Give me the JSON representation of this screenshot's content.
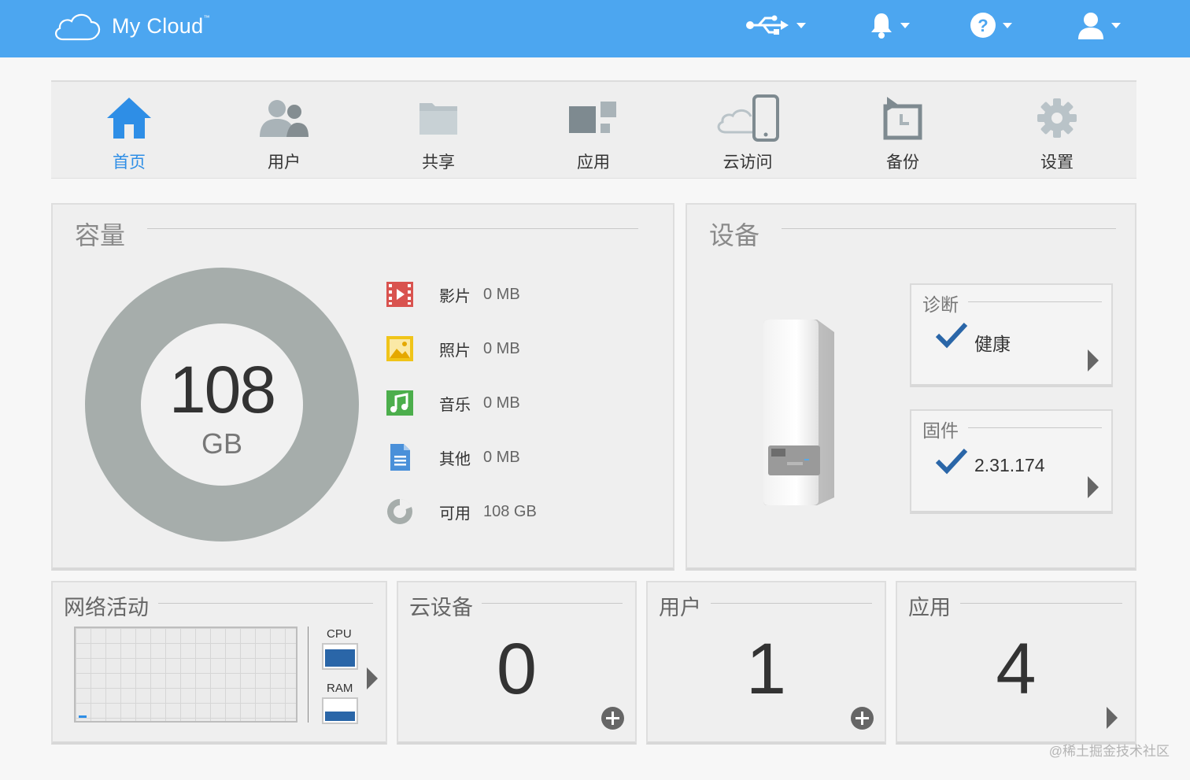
{
  "header": {
    "app_name": "My Cloud",
    "trademark": "™",
    "icons": [
      "cloud-logo-icon",
      "usb-icon",
      "bell-icon",
      "help-icon",
      "user-icon"
    ]
  },
  "nav": {
    "items": [
      {
        "label": "首页",
        "icon": "home-icon",
        "active": true
      },
      {
        "label": "用户",
        "icon": "users-icon"
      },
      {
        "label": "共享",
        "icon": "folder-icon"
      },
      {
        "label": "应用",
        "icon": "apps-icon"
      },
      {
        "label": "云访问",
        "icon": "cloud-device-icon"
      },
      {
        "label": "备份",
        "icon": "backup-icon"
      },
      {
        "label": "设置",
        "icon": "gear-icon"
      }
    ],
    "active_color": "#2e8ee6"
  },
  "capacity": {
    "title": "容量",
    "total_value": "108",
    "total_unit": "GB",
    "legend": [
      {
        "name": "影片",
        "value": "0 MB",
        "icon": "video-icon",
        "color": "#d9534f"
      },
      {
        "name": "照片",
        "value": "0 MB",
        "icon": "photo-icon",
        "color": "#f0c419"
      },
      {
        "name": "音乐",
        "value": "0 MB",
        "icon": "music-icon",
        "color": "#4cae4c"
      },
      {
        "name": "其他",
        "value": "0 MB",
        "icon": "document-icon",
        "color": "#4a90d9"
      },
      {
        "name": "可用",
        "value": "108 GB",
        "icon": "free-space-icon",
        "color": "#a6adab"
      }
    ]
  },
  "device": {
    "title": "设备",
    "diagnostics": {
      "title": "诊断",
      "value": "健康"
    },
    "firmware": {
      "title": "固件",
      "value": "2.31.174"
    }
  },
  "network": {
    "title": "网络活动",
    "cpu_label": "CPU",
    "ram_label": "RAM",
    "cpu_level": 0.85,
    "ram_level": 0.45
  },
  "cloud_devices": {
    "title": "云设备",
    "count": "0"
  },
  "users": {
    "title": "用户",
    "count": "1"
  },
  "apps": {
    "title": "应用",
    "count": "4"
  },
  "watermark": "@稀土掘金技术社区",
  "colors": {
    "header": "#4ca6f0",
    "check": "#2a66a8"
  }
}
